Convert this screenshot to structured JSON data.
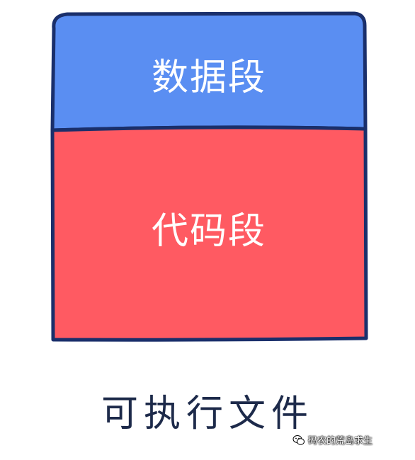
{
  "colors": {
    "data_segment_fill": "#5a8ef2",
    "code_segment_fill": "#ff5a62",
    "outline": "#1a2f6b",
    "caption_text": "#1d2a4a"
  },
  "segments": {
    "data": {
      "label": "数据段"
    },
    "code": {
      "label": "代码段"
    }
  },
  "caption": "可执行文件",
  "watermark": {
    "text": "码农的荒岛求生",
    "icon": "wechat-icon"
  }
}
